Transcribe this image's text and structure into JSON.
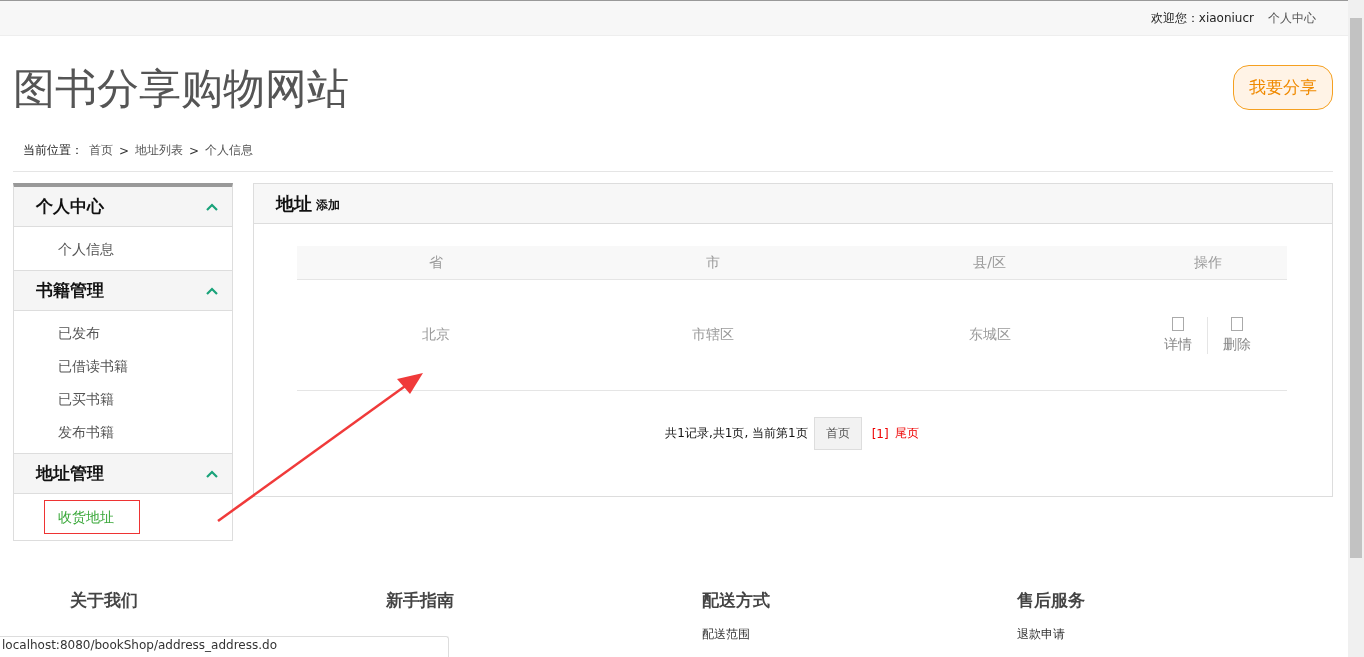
{
  "top_bar": {
    "welcome": "欢迎您：xiaoniucr",
    "user_center": "个人中心"
  },
  "header": {
    "site_title": "图书分享购物网站",
    "share_button": "我要分享"
  },
  "breadcrumb": {
    "label": "当前位置：",
    "items": [
      "首页",
      "地址列表",
      "个人信息"
    ],
    "separator": ">"
  },
  "sidebar": {
    "groups": [
      {
        "title": "个人中心",
        "expanded": true,
        "items": [
          {
            "label": "个人信息",
            "selected": false
          }
        ]
      },
      {
        "title": "书籍管理",
        "expanded": true,
        "items": [
          {
            "label": "已发布",
            "selected": false
          },
          {
            "label": "已借读书籍",
            "selected": false
          },
          {
            "label": "已买书籍",
            "selected": false
          },
          {
            "label": "发布书籍",
            "selected": false
          }
        ]
      },
      {
        "title": "地址管理",
        "expanded": true,
        "items": [
          {
            "label": "收货地址",
            "selected": true
          }
        ]
      }
    ]
  },
  "panel": {
    "title": "地址",
    "add_link": "添加",
    "table": {
      "columns": [
        "省",
        "市",
        "县/区",
        "操作"
      ],
      "rows": [
        {
          "province": "北京",
          "city": "市辖区",
          "district": "东城区",
          "actions": [
            "详情",
            "删除"
          ]
        }
      ]
    },
    "pagination": {
      "summary": "共1记录,共1页, 当前第1页",
      "first_button": "首页",
      "current": "[1]",
      "last_link": "尾页"
    }
  },
  "footer": {
    "columns": [
      {
        "title": "关于我们"
      },
      {
        "title": "新手指南"
      },
      {
        "title": "配送方式",
        "link": "配送范围"
      },
      {
        "title": "售后服务",
        "link": "退款申请"
      }
    ]
  },
  "status_bar": {
    "url": "localhost:8080/bookShop/address_address.do"
  }
}
